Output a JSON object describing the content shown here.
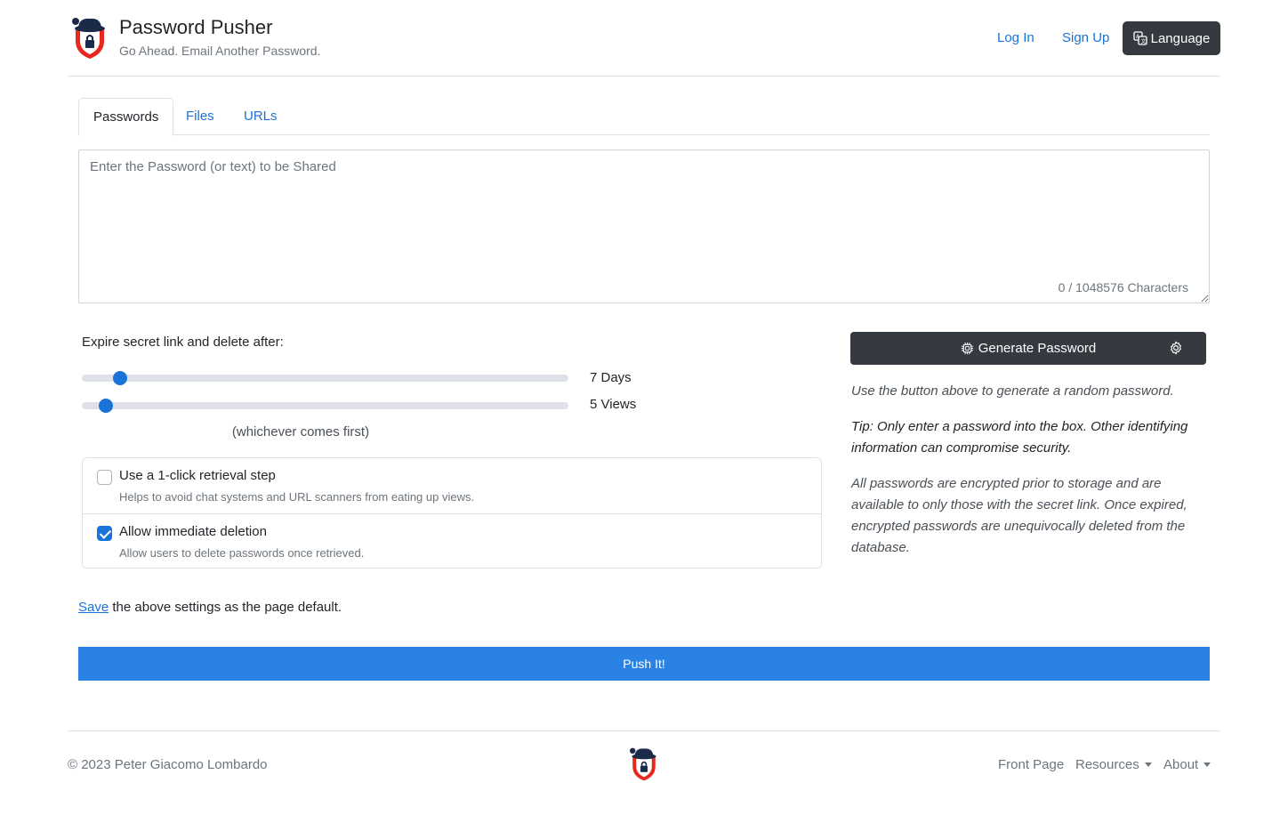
{
  "header": {
    "title": "Password Pusher",
    "tagline": "Go Ahead. Email Another Password.",
    "login_label": "Log In",
    "signup_label": "Sign Up",
    "language_label": "Language",
    "logo_icon": "hat-shield-lock-logo"
  },
  "tabs": [
    {
      "label": "Passwords",
      "active": true
    },
    {
      "label": "Files",
      "active": false
    },
    {
      "label": "URLs",
      "active": false
    }
  ],
  "payload": {
    "value": "",
    "placeholder": "Enter the Password (or text) to be Shared",
    "char_count": "0 / 1048576 Characters"
  },
  "expiration": {
    "label": "Expire secret link and delete after:",
    "days_label": "7 Days",
    "days_value": 7,
    "days_max": 90,
    "views_label": "5 Views",
    "views_value": 5,
    "views_max": 100,
    "whichever": "(whichever comes first)"
  },
  "options": [
    {
      "title": "Use a 1-click retrieval step",
      "help": "Helps to avoid chat systems and URL scanners from eating up views.",
      "checked": false
    },
    {
      "title": "Allow immediate deletion",
      "help": "Allow users to delete passwords once retrieved.",
      "checked": true
    }
  ],
  "save": {
    "link_label": "Save",
    "rest": " the above settings as the page default."
  },
  "push_label": "Push It!",
  "generator": {
    "label": "Generate Password",
    "icon": "cpu-icon",
    "settings_icon": "gear-icon",
    "hint": "Use the button above to generate a random password.",
    "tip": "Tip: Only enter a password into the box. Other identifying information can compromise security.",
    "info": "All passwords are encrypted prior to storage and are available to only those with the secret link. Once expired, encrypted passwords are unequivocally deleted from the database."
  },
  "footer": {
    "copyright": "© 2023 Peter Giacomo Lombardo",
    "links": [
      "Front Page",
      "Resources",
      "About"
    ]
  },
  "colors": {
    "accent": "#1a73d9",
    "push_button": "#2a82e4",
    "dark_button": "#343a40",
    "logo_red": "#e8281f"
  }
}
